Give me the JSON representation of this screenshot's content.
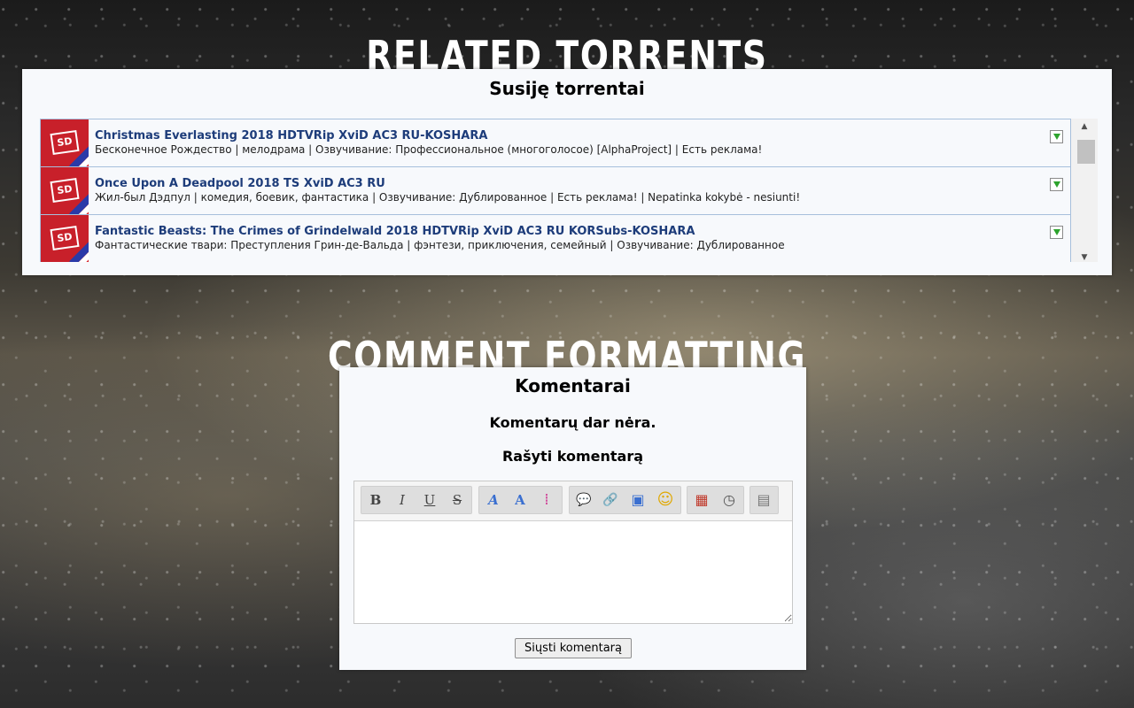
{
  "related": {
    "heading": "RELATED TORRENTS",
    "title": "Susiję torrentai",
    "items": [
      {
        "title": "Christmas Everlasting 2018 HDTVRip XviD AC3 RU-KOSHARA",
        "description": "Бесконечное Рождество | мелодрама | Озвучивание: Профессиональное (многоголосое) [AlphaProject] | Есть реклама!",
        "thumb_label": "SD"
      },
      {
        "title": "Once Upon A Deadpool 2018 TS XviD AC3 RU",
        "description": "Жил-был Дэдпул | комедия, боевик, фантастика | Озвучивание: Дублированное | Есть реклама! | Nepatinka kokybė - nesiunti!",
        "thumb_label": "SD"
      },
      {
        "title": "Fantastic Beasts: The Crimes of Grindelwald 2018 HDTVRip XviD AC3 RU KORSubs-KOSHARA",
        "description": "Фантастические твари: Преступления Грин-де-Вальда | фэнтези, приключения, семейный | Озвучивание: Дублированное",
        "thumb_label": "SD"
      }
    ],
    "scroll": {
      "up": "▲",
      "down": "▼"
    }
  },
  "comments": {
    "heading": "COMMENT FORMATTING",
    "title": "Komentarai",
    "empty_text": "Komentarų dar nėra.",
    "write_label": "Rašyti komentarą",
    "toolbar": {
      "bold": "B",
      "italic": "I",
      "underline": "U",
      "strike": "S",
      "font": "A",
      "font_size": "A",
      "colors": "⁞",
      "quote": "💬",
      "link": "🔗",
      "image": "▣",
      "smiley": "☺",
      "date": "▦",
      "time": "◷",
      "source": "▤"
    },
    "textarea_value": "",
    "submit_label": "Siųsti komentarą"
  },
  "colors": {
    "link": "#1d3c7a",
    "panel_bg": "#f7f9fc",
    "row_border": "#a7bfdc",
    "thumb_red": "#c8202a"
  }
}
